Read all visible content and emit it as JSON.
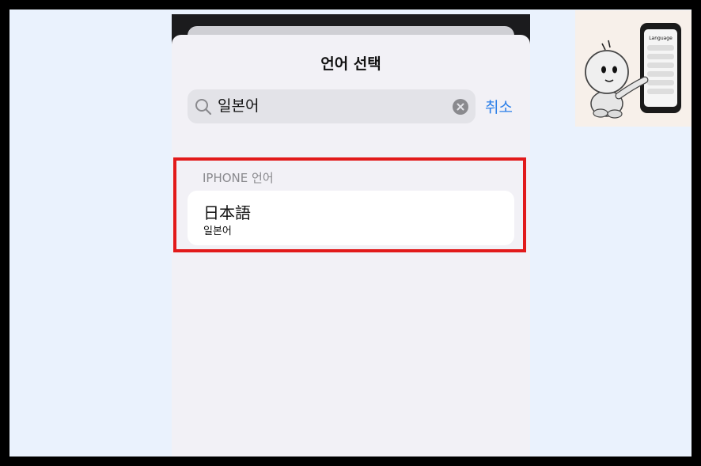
{
  "sheet": {
    "title": "언어 선택",
    "search": {
      "value": "일본어",
      "icon": "search-icon",
      "clear_icon": "clear-icon"
    },
    "cancel_label": "취소",
    "section_header": "IPHONE 언어",
    "results": [
      {
        "native_name": "日本語",
        "translated_name": "일본어"
      }
    ]
  },
  "mascot": {
    "screen_title": "Language"
  },
  "colors": {
    "accent": "#2a7ee8",
    "highlight": "#e21a1a",
    "sheet_background": "#f2f1f6",
    "page_background": "#eaf2fd"
  }
}
